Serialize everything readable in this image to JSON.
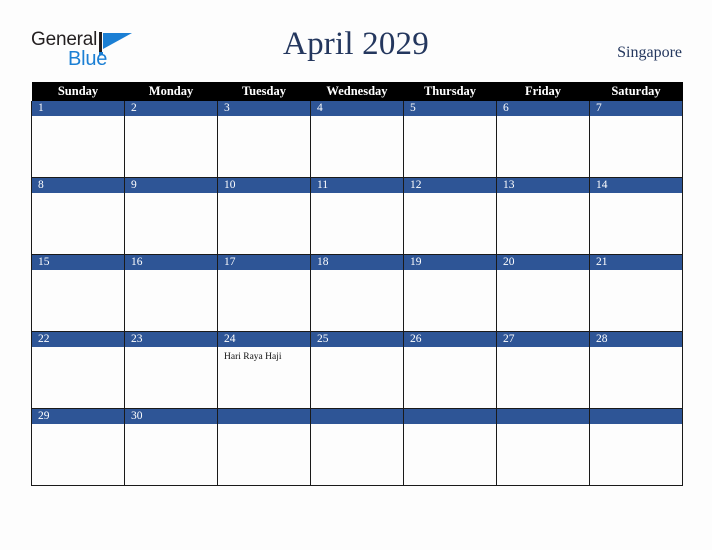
{
  "brand": {
    "name_part1": "General",
    "name_part2": "Blue",
    "mark_icon": "triangle-logo-icon",
    "accent_color": "#1b7fd4"
  },
  "header": {
    "title": "April 2029",
    "country": "Singapore",
    "title_color": "#24375e"
  },
  "calendar": {
    "weekday_headers": [
      "Sunday",
      "Monday",
      "Tuesday",
      "Wednesday",
      "Thursday",
      "Friday",
      "Saturday"
    ],
    "header_bg": "#000000",
    "daybar_bg": "#2e5596",
    "cell_bg": "#fdfdfd",
    "weeks": [
      [
        {
          "date": "1",
          "events": []
        },
        {
          "date": "2",
          "events": []
        },
        {
          "date": "3",
          "events": []
        },
        {
          "date": "4",
          "events": []
        },
        {
          "date": "5",
          "events": []
        },
        {
          "date": "6",
          "events": []
        },
        {
          "date": "7",
          "events": []
        }
      ],
      [
        {
          "date": "8",
          "events": []
        },
        {
          "date": "9",
          "events": []
        },
        {
          "date": "10",
          "events": []
        },
        {
          "date": "11",
          "events": []
        },
        {
          "date": "12",
          "events": []
        },
        {
          "date": "13",
          "events": []
        },
        {
          "date": "14",
          "events": []
        }
      ],
      [
        {
          "date": "15",
          "events": []
        },
        {
          "date": "16",
          "events": []
        },
        {
          "date": "17",
          "events": []
        },
        {
          "date": "18",
          "events": []
        },
        {
          "date": "19",
          "events": []
        },
        {
          "date": "20",
          "events": []
        },
        {
          "date": "21",
          "events": []
        }
      ],
      [
        {
          "date": "22",
          "events": []
        },
        {
          "date": "23",
          "events": []
        },
        {
          "date": "24",
          "events": [
            "Hari Raya Haji"
          ]
        },
        {
          "date": "25",
          "events": []
        },
        {
          "date": "26",
          "events": []
        },
        {
          "date": "27",
          "events": []
        },
        {
          "date": "28",
          "events": []
        }
      ],
      [
        {
          "date": "29",
          "events": []
        },
        {
          "date": "30",
          "events": []
        },
        {
          "date": "",
          "events": []
        },
        {
          "date": "",
          "events": []
        },
        {
          "date": "",
          "events": []
        },
        {
          "date": "",
          "events": []
        },
        {
          "date": "",
          "events": []
        }
      ]
    ]
  }
}
